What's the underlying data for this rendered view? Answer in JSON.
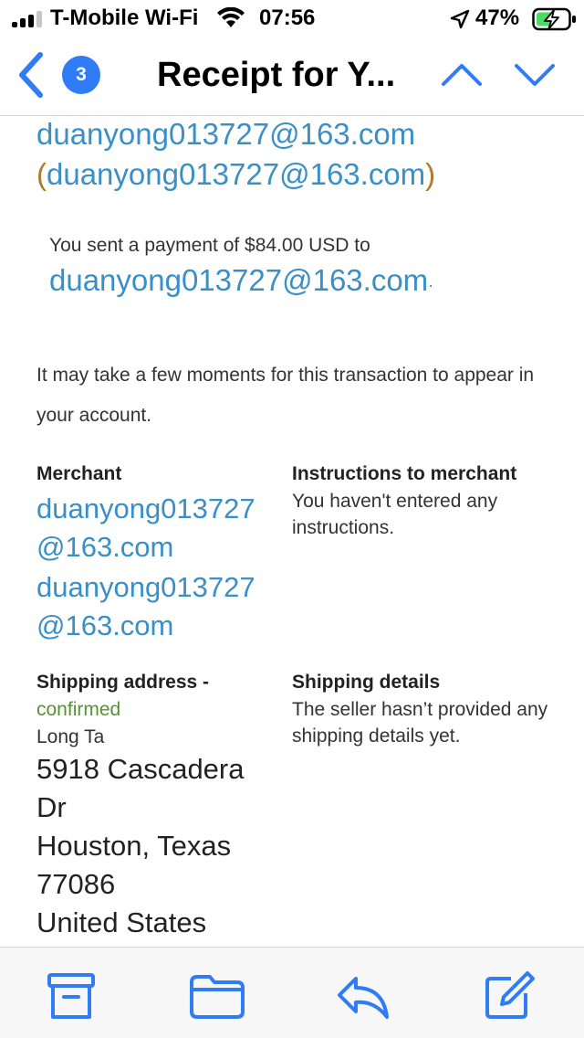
{
  "status_bar": {
    "carrier": "T-Mobile Wi-Fi",
    "time": "07:56",
    "battery": "47%",
    "icons": [
      "signal-icon",
      "wifi-icon",
      "location-icon",
      "battery-charging-icon"
    ]
  },
  "nav": {
    "unread_count": "3",
    "title": "Receipt for Y...",
    "icons": [
      "back-chevron-icon",
      "up-chevron-icon",
      "down-chevron-icon"
    ],
    "accent_color": "#2f7cf6"
  },
  "email": {
    "recipient_line": "duanyong013727@163.com",
    "recipient_paren_open": "(",
    "recipient_email_paren": "duanyong013727@163.com",
    "recipient_paren_close": ")",
    "sent_text": "You sent a payment of $84.00 USD to",
    "sent_email": "duanyong013727@163.com",
    "sent_trailing": "·",
    "moments_text": "It may take a few moments for this transaction to appear in your account.",
    "merchant_label": "Merchant",
    "merchant_email_1": "duanyong013727@163.com",
    "merchant_email_2": "duanyong013727@163.com",
    "instructions_label": "Instructions to merchant",
    "instructions_text": "You haven't entered any instructions.",
    "shipping_address_label": "Shipping address -",
    "shipping_status": "confirmed",
    "shipping_name": "Long Ta",
    "address_line1": "5918 Cascadera Dr",
    "address_line2": "Houston, Texas 77086",
    "address_country": "United States",
    "shipping_details_label": "Shipping details",
    "shipping_details_text": "The seller hasn’t provided any shipping details yet.",
    "link_color": "#3a8fc7",
    "confirmed_color": "#5a8f3a"
  },
  "toolbar": {
    "icons": [
      "archive-icon",
      "folder-icon",
      "reply-icon",
      "compose-icon"
    ]
  }
}
